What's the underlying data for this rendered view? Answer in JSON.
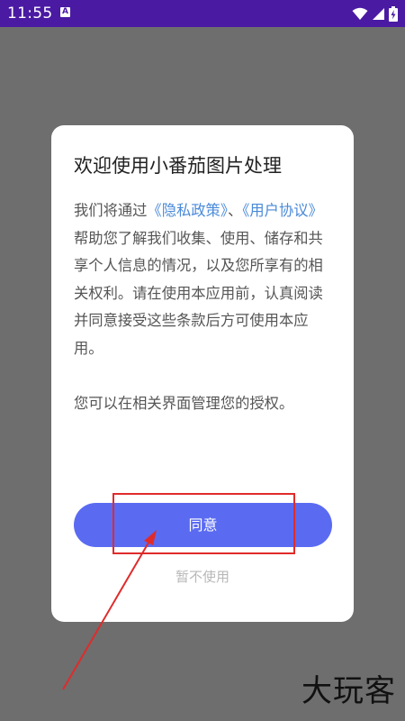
{
  "status_bar": {
    "time": "11:55",
    "notification_badge": "A",
    "icons": [
      "wifi-icon",
      "signal-icon",
      "battery-icon"
    ]
  },
  "dialog": {
    "title": "欢迎使用小番茄图片处理",
    "body": {
      "intro": "我们将通过",
      "privacy_link": "《隐私政策》",
      "separator": "、",
      "agreement_link": "《用户协议》",
      "rest": "帮助您了解我们收集、使用、储存和共享个人信息的情况，以及您所享有的相关权利。请在使用本应用前，认真阅读并同意接受这些条款后方可使用本应用。",
      "paragraph2": "您可以在相关界面管理您的授权。"
    },
    "agree_button": "同意",
    "decline_link": "暂不使用"
  },
  "watermark": "大玩客",
  "colors": {
    "status_bar": "#4a1aa3",
    "overlay": "#6e6e6e",
    "primary_button": "#5a6bf2",
    "link": "#4a8ad8",
    "annotation": "#e02b2b"
  }
}
